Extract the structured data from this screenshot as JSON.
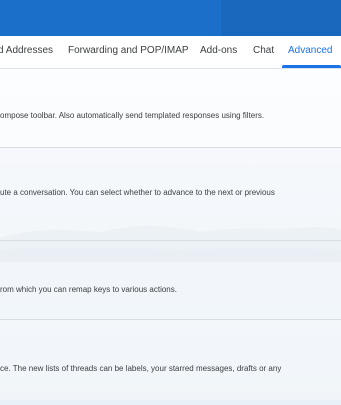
{
  "tabs": [
    {
      "label": "d Addresses"
    },
    {
      "label": "Forwarding and POP/IMAP"
    },
    {
      "label": "Add-ons"
    },
    {
      "label": "Chat"
    },
    {
      "label": "Advanced"
    }
  ],
  "rows": [
    {
      "text": "ompose toolbar. Also automatically send templated responses using filters."
    },
    {
      "text": "ute a conversation. You can select whether to advance to the next or previous"
    },
    {
      "text": "rom which you can remap keys to various actions."
    },
    {
      "text": "ce. The new lists of threads can be labels, your starred messages, drafts or any"
    }
  ],
  "colors": {
    "header": "#1c6fc9",
    "accent": "#1a73e8"
  }
}
